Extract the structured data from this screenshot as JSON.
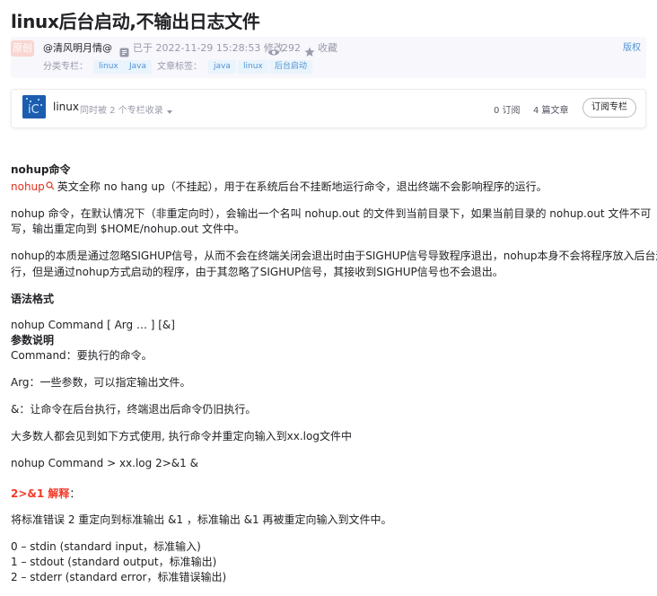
{
  "article": {
    "title": "linux后台启动,不输出日志文件"
  },
  "meta": {
    "original_badge": "原创",
    "author": "@清风明月情@",
    "timestamp": "已于 2022-11-29 15:28:53 修改",
    "views": "292",
    "favorite_label": "收藏",
    "copyright_label": "版权",
    "column_label": "分类专栏：",
    "columns": [
      "linux",
      "Java"
    ],
    "tag_label": "文章标签：",
    "tags": [
      "java",
      "linux",
      "后台启动"
    ]
  },
  "column_card": {
    "name": "linux",
    "included_text": "同时被 2 个专栏收录",
    "subscribers": "0 订阅",
    "articles": "4 篇文章",
    "subscribe_button": "订阅专栏"
  },
  "content": {
    "h_nohup": "nohup命令",
    "keyword": "nohup",
    "p1": "英文全称 no hang up（不挂起），用于在系统后台不挂断地运行命令，退出终端不会影响程序的运行。",
    "p2_line1": "nohup 命令，在默认情况下（非重定向时），会输出一个名叫 nohup.out 的文件到当前目录下，如果当前目录的 nohup.out 文件不可",
    "p2_line2": "写，输出重定向到 $HOME/nohup.out 文件中。",
    "p3_line1": "nohup的本质是通过忽略SIGHUP信号，从而不会在终端关闭会退出时由于SIGHUP信号导致程序退出，nohup本身不会将程序放入后台运",
    "p3_line2": "行，但是通过nohup方式启动的程序，由于其忽略了SIGHUP信号，其接收到SIGHUP信号也不会退出。",
    "h_syntax": "语法格式",
    "syntax": "nohup Command [ Arg … ] [&]",
    "h_params": "参数说明",
    "param_command": "Command：要执行的命令。",
    "param_arg": "Arg：一些参数，可以指定输出文件。",
    "param_amp": "&：让命令在后台执行，终端退出后命令仍旧执行。",
    "usage_intro": "大多数人都会见到如下方式使用, 执行命令并重定向输入到xx.log文件中",
    "usage_cmd": "nohup Command > xx.log 2>&1 &",
    "h_explain_red": "2>&1 解释",
    "h_explain_colon": "：",
    "explain": "将标准错误 2 重定向到标准输出 &1 ，标准输出 &1 再被重定向输入到文件中。",
    "fd0": "0 – stdin (standard input，标准输入)",
    "fd1": "1 – stdout (standard output，标准输出)",
    "fd2": "2 – stderr (standard error，标准错误输出)"
  }
}
